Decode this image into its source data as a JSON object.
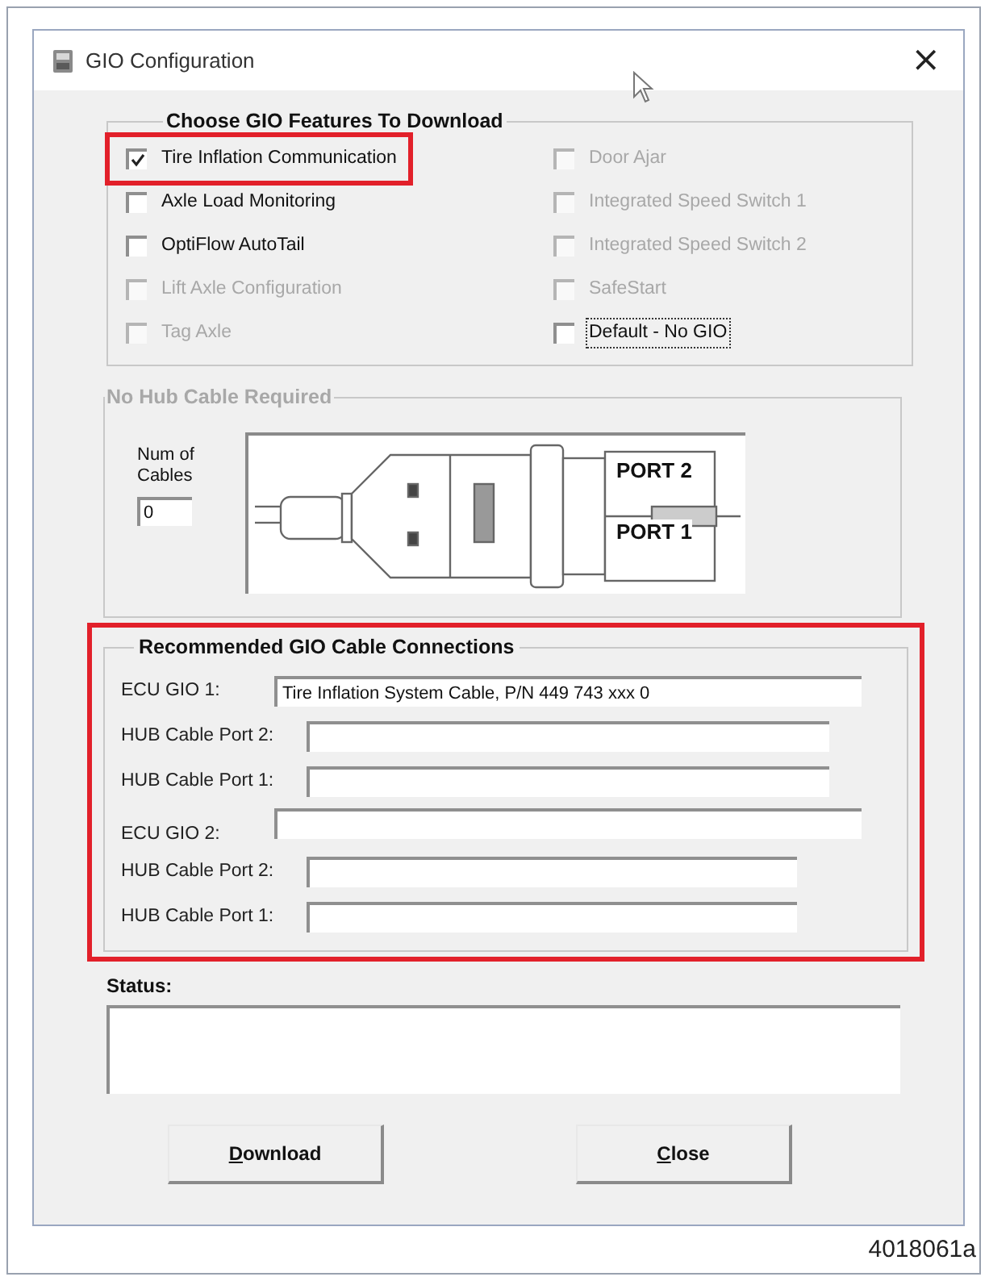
{
  "window": {
    "title": "GIO Configuration",
    "close": "×"
  },
  "features": {
    "title": "Choose GIO Features To Download",
    "left_column": [
      {
        "label": "Tire Inflation Communication",
        "checked": true,
        "disabled": false,
        "focused": false,
        "highlighted": true
      },
      {
        "label": "Axle Load Monitoring",
        "checked": false,
        "disabled": false,
        "focused": false,
        "highlighted": false
      },
      {
        "label": "OptiFlow AutoTail",
        "checked": false,
        "disabled": false,
        "focused": false,
        "highlighted": false
      },
      {
        "label": "Lift Axle Configuration",
        "checked": false,
        "disabled": true,
        "focused": false,
        "highlighted": false
      },
      {
        "label": "Tag Axle",
        "checked": false,
        "disabled": true,
        "focused": false,
        "highlighted": false
      }
    ],
    "right_column": [
      {
        "label": "Door Ajar",
        "checked": false,
        "disabled": true,
        "focused": false,
        "highlighted": false
      },
      {
        "label": "Integrated Speed Switch 1",
        "checked": false,
        "disabled": true,
        "focused": false,
        "highlighted": false
      },
      {
        "label": "Integrated Speed Switch 2",
        "checked": false,
        "disabled": true,
        "focused": false,
        "highlighted": false
      },
      {
        "label": "SafeStart",
        "checked": false,
        "disabled": true,
        "focused": false,
        "highlighted": false
      },
      {
        "label": "Default - No GIO",
        "checked": false,
        "disabled": false,
        "focused": true,
        "highlighted": false
      }
    ]
  },
  "hub": {
    "title": "No Hub Cable Required",
    "disabled": true,
    "num_label": "Num of Cables",
    "num_value": "0",
    "port_labels": [
      "PORT 2",
      "PORT 1"
    ]
  },
  "recommended": {
    "title": "Recommended GIO Cable Connections",
    "highlighted": true,
    "rows": [
      {
        "label": "ECU GIO 1:",
        "value": "Tire Inflation System Cable, P/N 449 743 xxx 0",
        "kind": "ecu"
      },
      {
        "label": "HUB Cable Port 2:",
        "kind": "hub"
      },
      {
        "label": "HUB Cable Port 1:",
        "kind": "hub"
      },
      {
        "label": "ECU GIO 2:",
        "kind": "ecu"
      },
      {
        "label": "HUB Cable Port 2:",
        "kind": "hub2"
      },
      {
        "label": "HUB Cable Port 1:",
        "kind": "hub2"
      }
    ]
  },
  "status": {
    "label": "Status:"
  },
  "buttons": [
    {
      "label": "Download",
      "access_key_underlined": true
    },
    {
      "label": "Close",
      "access_key_underlined": true
    }
  ],
  "caption": "4018061a"
}
